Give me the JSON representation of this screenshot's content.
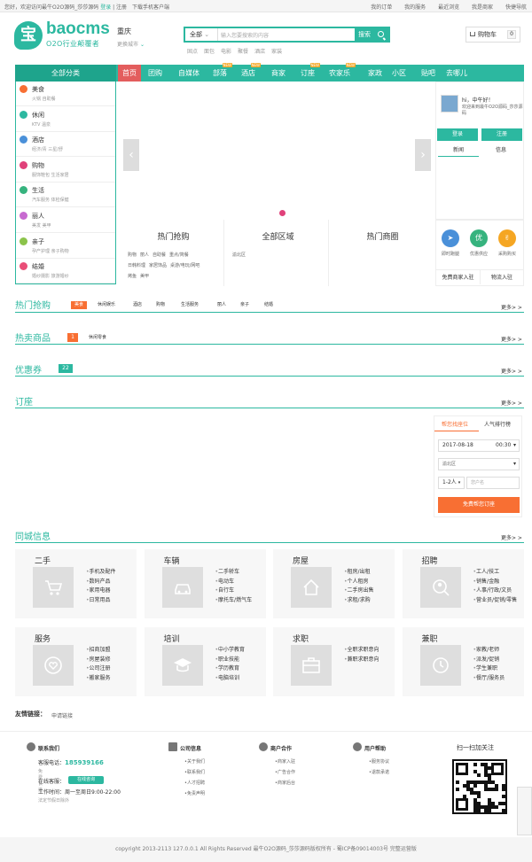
{
  "topbar": {
    "greeting": "您好，欢迎访问最牛O2O源码_莎莎源码",
    "login": "登录",
    "register": "注册",
    "app": "下载手机客户端",
    "right": [
      "我的订单",
      "我的服务",
      "最近浏览",
      "我是商家",
      "快捷导航"
    ]
  },
  "logo": {
    "mark": "宝",
    "name": "baocms",
    "slogan": "O2O行业颠覆者"
  },
  "city": {
    "name": "重庆",
    "change": "更换城市"
  },
  "search": {
    "select": "全部",
    "placeholder": "输入您要搜索的内容",
    "button": "搜索",
    "hotwords": [
      "固点",
      "面包",
      "电影",
      "聚餐",
      "酒店",
      "家装"
    ]
  },
  "cart": {
    "label": "购物车",
    "count": "0"
  },
  "nav": {
    "all": "全部分类",
    "items": [
      {
        "label": "首页",
        "active": true,
        "new": false
      },
      {
        "label": "团购",
        "new": false
      },
      {
        "label": "自媒体",
        "new": false
      },
      {
        "label": "部落",
        "new": true
      },
      {
        "label": "酒店",
        "new": true
      },
      {
        "label": "商家",
        "new": false
      },
      {
        "label": "订座",
        "new": true
      },
      {
        "label": "农家乐",
        "new": true
      },
      {
        "label": "家政",
        "new": false
      },
      {
        "label": "小区",
        "new": false
      },
      {
        "label": "贴吧",
        "new": false
      },
      {
        "label": "去哪儿",
        "new": false
      }
    ],
    "new_badge": "NEW"
  },
  "categories": [
    {
      "name": "美食",
      "sub": "火锅  自助餐",
      "color": "#f86f33"
    },
    {
      "name": "休闲",
      "sub": "KTV  温泉",
      "color": "#2cb8a0"
    },
    {
      "name": "酒店",
      "sub": "经济/青  三星/舒",
      "color": "#4a90d9"
    },
    {
      "name": "购物",
      "sub": "服饰鞋包  生活家居",
      "color": "#e0417a"
    },
    {
      "name": "生活",
      "sub": "汽车服务  体检保健",
      "color": "#36b37e"
    },
    {
      "name": "丽人",
      "sub": "美发  美甲",
      "color": "#c76ad0"
    },
    {
      "name": "亲子",
      "sub": "孕产护理  亲子购物",
      "color": "#8bc34a"
    },
    {
      "name": "结婚",
      "sub": "婚纱摄影  旅游婚纱",
      "color": "#e94e77"
    }
  ],
  "login_box": {
    "hi": "hi，中午好！",
    "welcome": "欢迎来到最牛O2O源码_莎莎源码",
    "login": "登录",
    "register": "注册",
    "tabs": [
      "新闻",
      "信息"
    ]
  },
  "panels": [
    {
      "title": "热门抢购",
      "lines": [
        [
          "购物",
          "丽人",
          "自助餐",
          "重点/简餐"
        ],
        [
          "日韩料理",
          "家居饰品",
          "桌游/电玩/网吧"
        ],
        [
          "烤鱼",
          "美甲"
        ]
      ]
    },
    {
      "title": "全部区域",
      "lines": [
        [
          "渝北区"
        ]
      ]
    },
    {
      "title": "热门商圈",
      "lines": []
    }
  ],
  "quick": [
    {
      "label": "即时跑腿",
      "color": "#4a90d9",
      "icon": "plane-icon"
    },
    {
      "label": "优惠供应",
      "color": "#36b37e",
      "icon": "you-icon",
      "glyph": "优"
    },
    {
      "label": "采购购买",
      "color": "#f5a623",
      "icon": "thumb-icon"
    }
  ],
  "quick_btns": [
    "免费商家入驻",
    "物流入驻"
  ],
  "hot_buy": {
    "title": "热门抢购",
    "tabs": [
      "美食",
      "休闲娱乐",
      "酒店",
      "购物",
      "生活服务",
      "丽人",
      "亲子",
      "结婚"
    ],
    "more": "更多> >"
  },
  "hot_sale": {
    "title": "热卖商品",
    "badge": "1",
    "tab": "休闲零食",
    "more": "更多> >"
  },
  "coupon": {
    "title": "优惠券",
    "badge": "22",
    "more": "更多> >"
  },
  "booking": {
    "title": "订座",
    "more": "更多> >",
    "tabs": [
      "帮您找座位",
      "人气排行榜"
    ],
    "date": "2017-08-18",
    "time": "00:30",
    "area": "渝北区",
    "people": "1-2人",
    "name_placeholder": "您户名",
    "button": "免费帮您订座"
  },
  "local": {
    "title": "同城信息",
    "more": "更多> >",
    "cards": [
      {
        "title": "二手",
        "icon": "cart-icon",
        "items": [
          "手机及配件",
          "数码产品",
          "家用电器",
          "日常用品"
        ]
      },
      {
        "title": "车辆",
        "icon": "car-icon",
        "items": [
          "二手轿车",
          "电动车",
          "自行车",
          "摩托车/燃气车"
        ]
      },
      {
        "title": "房屋",
        "icon": "house-icon",
        "items": [
          "租房/出租",
          "个人租房",
          "二手房出售",
          "求租/求购"
        ]
      },
      {
        "title": "招聘",
        "icon": "person-search-icon",
        "items": [
          "工人/技工",
          "销售/金融",
          "人事/行政/文员",
          "营业员/促销/零售"
        ]
      },
      {
        "title": "服务",
        "icon": "heart-icon",
        "items": [
          "招商加盟",
          "房屋装修",
          "公司注册",
          "搬家服务"
        ]
      },
      {
        "title": "培训",
        "icon": "graduation-icon",
        "items": [
          "中小学教育",
          "职业技能",
          "学历教育",
          "电脑培训"
        ]
      },
      {
        "title": "求职",
        "icon": "briefcase-icon",
        "items": [
          "全职求职意向",
          "兼职求职意向"
        ]
      },
      {
        "title": "兼职",
        "icon": "clock-icon",
        "items": [
          "家教/老师",
          "派发/促销",
          "学生兼职",
          "餐厅/服务员"
        ]
      }
    ]
  },
  "friend_links": {
    "label": "友情链接：",
    "apply": "申请链接"
  },
  "footer": {
    "contact": {
      "title": "联系我们",
      "phone_label": "客服电话：",
      "phone": "185939166",
      "note": "免费长途",
      "online_label": "在线客服：",
      "online_btn": "在线咨询",
      "hours": "工作时间：周一至周日9:00-22:00",
      "holiday": "法定节假日除外"
    },
    "cols": [
      {
        "title": "公司信息",
        "items": [
          "关于我们",
          "联系我们",
          "人才招聘",
          "免责声明"
        ]
      },
      {
        "title": "商户合作",
        "items": [
          "商家入驻",
          "广告合作",
          "商家后台"
        ]
      },
      {
        "title": "用户帮助",
        "items": [
          "服务协议",
          "退款承诺"
        ]
      }
    ],
    "qr_title": "扫一扫加关注"
  },
  "copyright": "copyright 2013-2113 127.0.0.1 All Rights Reserved 最牛O2O源码_莎莎源码版权所有 - 蜀ICP备09014003号 完整运营版"
}
